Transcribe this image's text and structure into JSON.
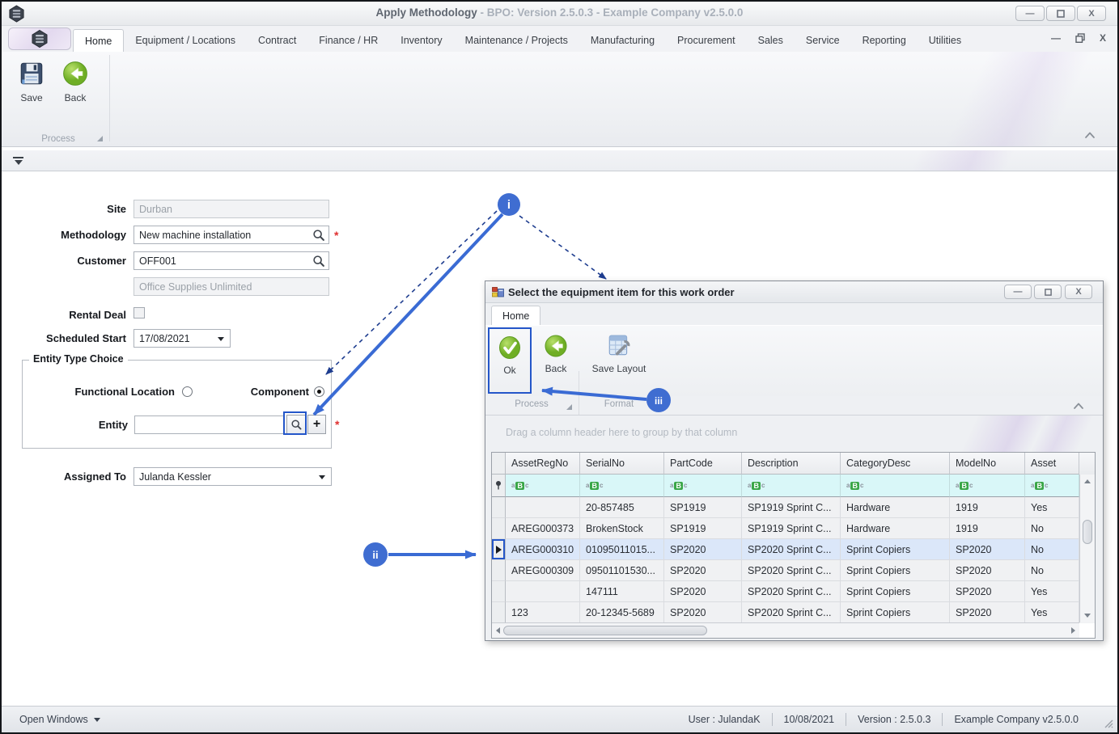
{
  "window": {
    "title": "Apply Methodology",
    "title_suffix": " - BPO: Version 2.5.0.3 - Example Company v2.5.0.0"
  },
  "ribbon": {
    "tabs": [
      "Home",
      "Equipment / Locations",
      "Contract",
      "Finance / HR",
      "Inventory",
      "Maintenance / Projects",
      "Manufacturing",
      "Procurement",
      "Sales",
      "Service",
      "Reporting",
      "Utilities"
    ],
    "active_tab": "Home",
    "save_label": "Save",
    "back_label": "Back",
    "group_label": "Process"
  },
  "form": {
    "site_label": "Site",
    "site_value": "Durban",
    "methodology_label": "Methodology",
    "methodology_value": "New machine installation",
    "customer_label": "Customer",
    "customer_value": "OFF001",
    "customer_name_value": "Office Supplies Unlimited",
    "rental_label": "Rental Deal",
    "scheduled_label": "Scheduled Start",
    "scheduled_value": "17/08/2021",
    "entity_group_title": "Entity Type Choice",
    "radio_functional_label": "Functional Location",
    "radio_component_label": "Component",
    "entity_label": "Entity",
    "entity_value": "",
    "assigned_label": "Assigned To",
    "assigned_value": "Julanda Kessler",
    "required_marker": "*"
  },
  "dialog": {
    "title": "Select the equipment item for this work order",
    "tab": "Home",
    "ok_label": "Ok",
    "back_label": "Back",
    "save_layout_label": "Save Layout",
    "process_group_label": "Process",
    "format_group_label": "Format",
    "groupby_text": "Drag a column header here to group by that column",
    "grid": {
      "columns": [
        "AssetRegNo",
        "SerialNo",
        "PartCode",
        "Description",
        "CategoryDesc",
        "ModelNo",
        "Asset"
      ],
      "rows": [
        [
          "",
          "20-857485",
          "SP1919",
          "SP1919 Sprint C...",
          "Hardware",
          "1919",
          "Yes"
        ],
        [
          "AREG000373",
          "BrokenStock",
          "SP1919",
          "SP1919 Sprint C...",
          "Hardware",
          "1919",
          "No"
        ],
        [
          "AREG000310",
          "01095011015...",
          "SP2020",
          "SP2020 Sprint C...",
          "Sprint Copiers",
          "SP2020",
          "No"
        ],
        [
          "AREG000309",
          "09501101530...",
          "SP2020",
          "SP2020 Sprint C...",
          "Sprint Copiers",
          "SP2020",
          "No"
        ],
        [
          "",
          "147111",
          "SP2020",
          "SP2020 Sprint C...",
          "Sprint Copiers",
          "SP2020",
          "Yes"
        ],
        [
          "123",
          "20-12345-5689",
          "SP2020",
          "SP2020 Sprint C...",
          "Sprint Copiers",
          "SP2020",
          "Yes"
        ]
      ],
      "selected_row_index": 2
    }
  },
  "callouts": {
    "one": "i",
    "two": "ii",
    "three": "iii"
  },
  "statusbar": {
    "open_windows": "Open Windows",
    "user": "User : JulandaK",
    "date": "10/08/2021",
    "version": "Version : 2.5.0.3",
    "company": "Example Company v2.5.0.0"
  },
  "colors": {
    "highlight_blue": "#2456c9",
    "callout_blue": "#3f6dd1",
    "required_red": "#e03030",
    "filter_row_cyan": "#d9f7f8",
    "selected_row_blue": "#dbe7f9",
    "icon_green": "#76b82a"
  }
}
